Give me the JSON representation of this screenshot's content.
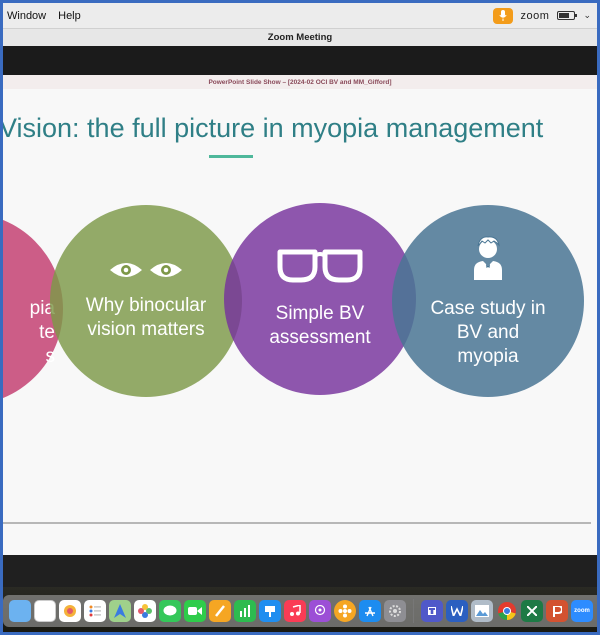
{
  "menubar": {
    "items": [
      "Window",
      "Help"
    ],
    "zoom_brand": "zoom",
    "chevron": "⌄"
  },
  "window": {
    "title": "Zoom Meeting"
  },
  "ppt": {
    "header": "PowerPoint Slide Show – [2024-02 OCI BV and MM_Gifford]",
    "slide_title": "Vision: the full picture in myopia management",
    "circles": [
      {
        "label_lines": [
          "pia",
          "te",
          "s"
        ],
        "color": "#c44273"
      },
      {
        "label": "Why binocular vision matters",
        "icon": "eyes-icon",
        "color": "#7d9848"
      },
      {
        "label": "Simple BV assessment",
        "icon": "glasses-icon",
        "color": "#76329c"
      },
      {
        "label": "Case study in BV and myopia",
        "icon": "person-icon",
        "color": "#4a7694"
      }
    ]
  },
  "dock": {
    "icons": [
      "finder-icon",
      "calendar-icon",
      "photos-icon",
      "reminders-icon",
      "maps-icon",
      "photos-app-icon",
      "messages-icon",
      "facetime-icon",
      "pages-icon",
      "numbers-icon",
      "keynote-icon",
      "music-icon",
      "podcasts-icon",
      "flower-app-icon",
      "app-store-icon",
      "system-settings-icon",
      "teams-icon",
      "word-icon",
      "preview-icon",
      "chrome-icon",
      "excel-icon",
      "powerpoint-icon",
      "zoom-icon"
    ],
    "zoom_label": "zoom"
  }
}
